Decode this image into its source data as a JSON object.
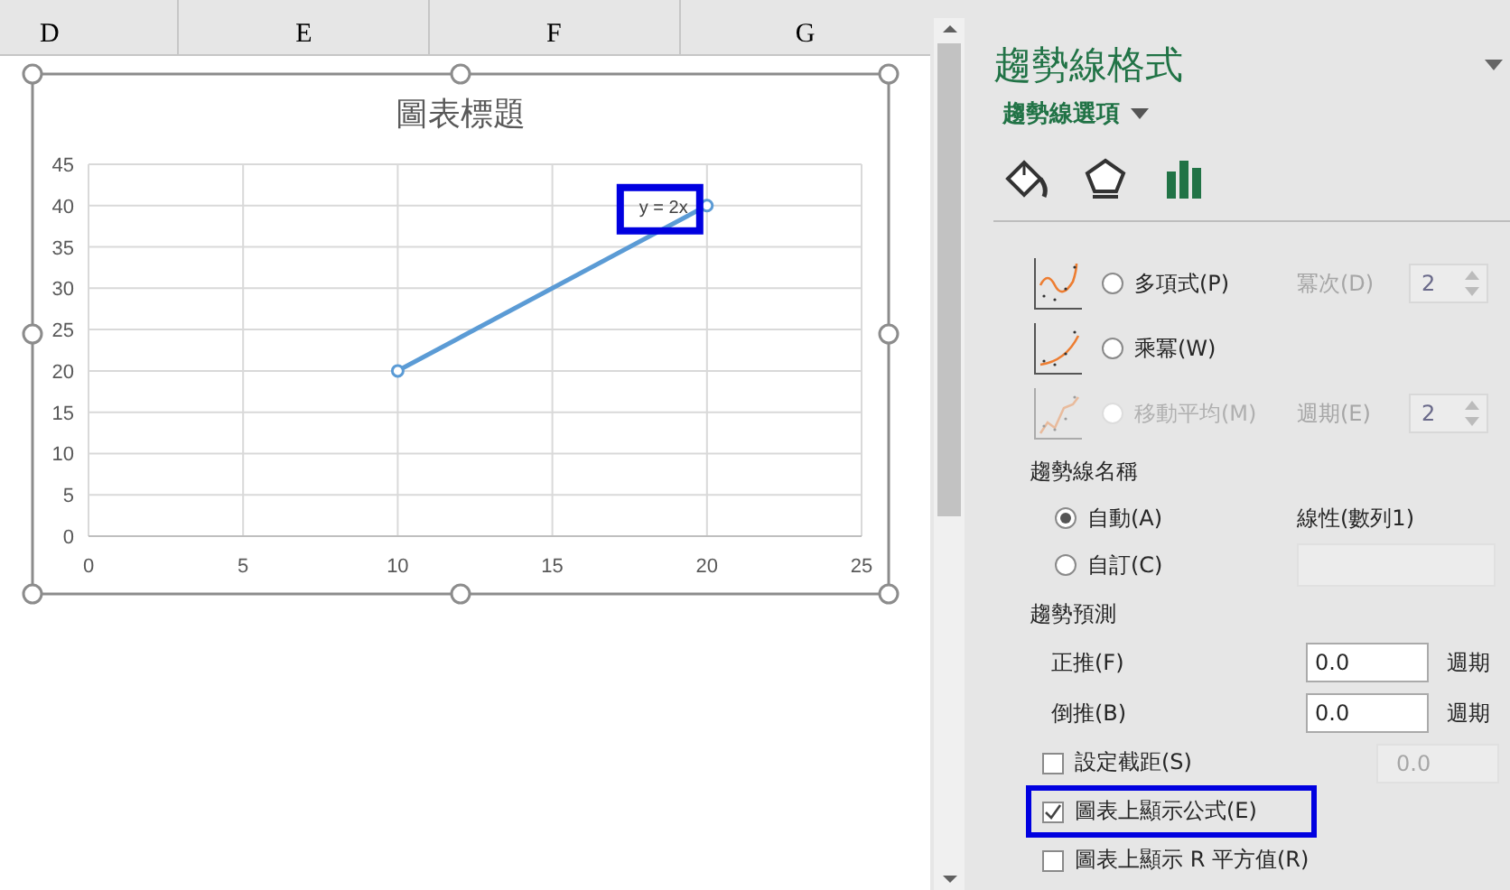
{
  "sheet": {
    "columns": [
      "D",
      "E",
      "F",
      "G"
    ]
  },
  "chart": {
    "chart_data": {
      "type": "line",
      "title": "圖表標題",
      "x": [
        10,
        20
      ],
      "series": [
        {
          "color": "#5b9bd5",
          "marker": true,
          "values": [
            20,
            40
          ]
        }
      ],
      "grid": true,
      "xlim": [
        0,
        25
      ],
      "ylim": [
        0,
        45
      ],
      "xticks": [
        0,
        5,
        10,
        15,
        20,
        25
      ],
      "yticks": [
        0,
        5,
        10,
        15,
        20,
        25,
        30,
        35,
        40,
        45
      ]
    },
    "trendline_label": "y = 2x",
    "label_highlighted": true
  },
  "panel": {
    "title": "趨勢線格式",
    "subtitle": "趨勢線選項",
    "tabs": [
      {
        "kind": "fill",
        "selected": false
      },
      {
        "kind": "effects",
        "selected": false
      },
      {
        "kind": "options",
        "selected": true
      }
    ],
    "trend_types": [
      {
        "kind": "polynomial",
        "label": "多項式(P)",
        "selected": false,
        "disabled": false,
        "param_label": "冪次(D)",
        "param_value": "2"
      },
      {
        "kind": "power",
        "label": "乘冪(W)",
        "selected": false,
        "disabled": false
      },
      {
        "kind": "moving_average",
        "label": "移動平均(M)",
        "selected": false,
        "disabled": true,
        "param_label": "週期(E)",
        "param_value": "2"
      }
    ],
    "name_section": {
      "heading": "趨勢線名稱",
      "options": [
        {
          "label": "自動(A)",
          "selected": true,
          "kind": "text",
          "value": "線性(數列1)"
        },
        {
          "label": "自訂(C)",
          "selected": false,
          "kind": "field"
        }
      ]
    },
    "forecast": {
      "heading": "趨勢預測",
      "rows": [
        {
          "label": "正推(F)",
          "value": "0.0",
          "unit": "週期"
        },
        {
          "label": "倒推(B)",
          "value": "0.0",
          "unit": "週期"
        }
      ]
    },
    "checks": [
      {
        "label": "設定截距(S)",
        "checked": false,
        "highlighted": false,
        "placeholder": "0.0"
      },
      {
        "label": "圖表上顯示公式(E)",
        "checked": true,
        "highlighted": true
      },
      {
        "label": "圖表上顯示 R 平方值(R)",
        "checked": false,
        "highlighted": false
      }
    ]
  }
}
